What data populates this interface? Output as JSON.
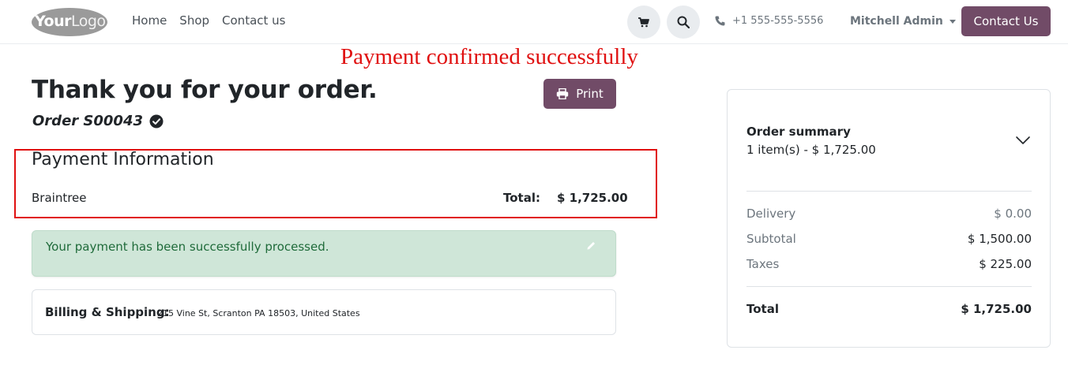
{
  "header": {
    "logo_your": "Your",
    "logo_logo": "Logo",
    "nav": [
      "Home",
      "Shop",
      "Contact us"
    ],
    "phone": "+1 555-555-5556",
    "user": "Mitchell Admin",
    "contact_button": "Contact Us",
    "icons": [
      "cart-icon",
      "search-icon",
      "phone-icon",
      "caret-down-icon"
    ]
  },
  "annotation": "Payment confirmed successfully",
  "main": {
    "title": "Thank you for your order.",
    "order_ref": "Order S00043",
    "print_label": "Print",
    "payment": {
      "heading": "Payment Information",
      "method": "Braintree",
      "total_label": "Total:",
      "total_value": "$ 1,725.00"
    },
    "alert": "Your payment has been successfully processed.",
    "billing_label": "Billing & Shipping:",
    "billing_address": "215 Vine St, Scranton PA 18503, United States"
  },
  "summary": {
    "title": "Order summary",
    "subtitle": "1 item(s) -  $ 1,725.00",
    "rows": [
      {
        "label": "Delivery",
        "value": "$ 0.00"
      },
      {
        "label": "Subtotal",
        "value": "$ 1,500.00"
      },
      {
        "label": "Taxes",
        "value": "$ 225.00"
      }
    ],
    "total_label": "Total",
    "total_value": "$ 1,725.00"
  },
  "colors": {
    "brand": "#714b67",
    "annotation": "#e01010",
    "success_bg": "#cfe6d8",
    "success_text": "#1f6b3a"
  }
}
